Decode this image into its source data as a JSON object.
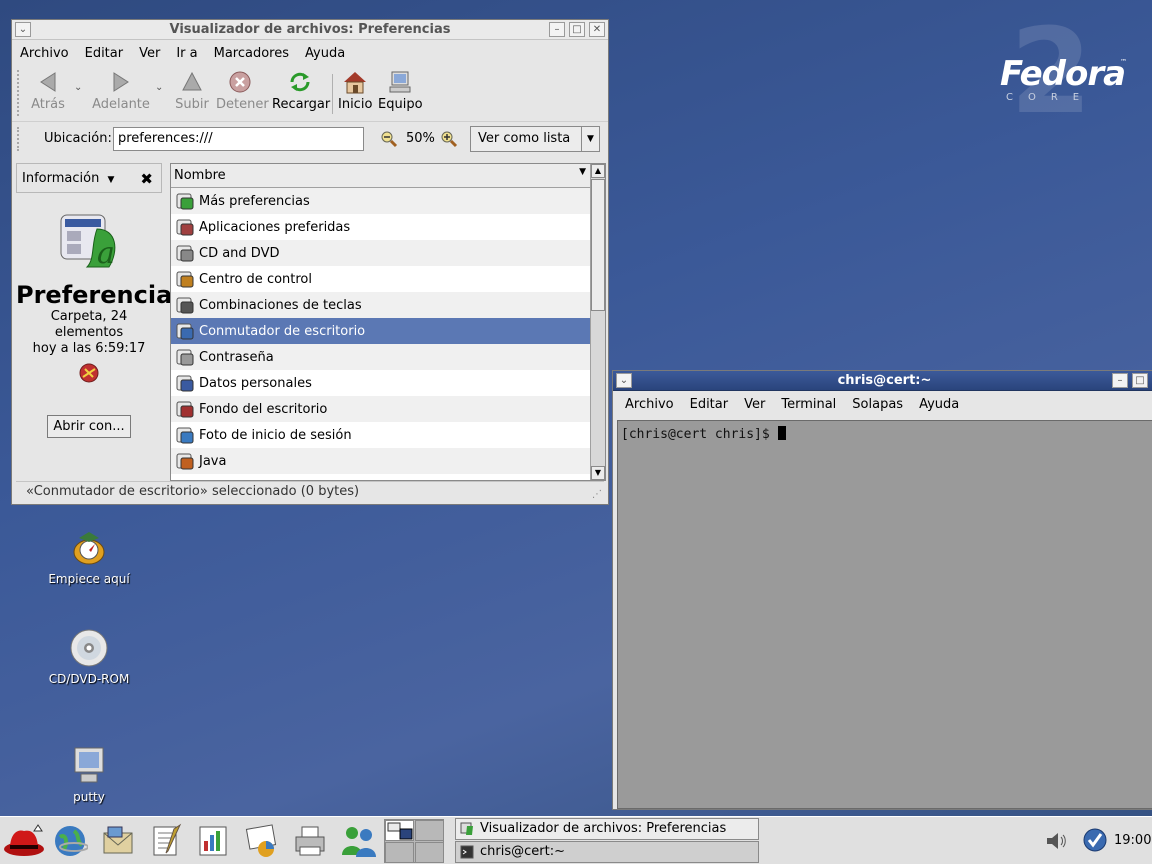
{
  "desktop": {
    "logo": {
      "word": "Fedora",
      "sub": "CORE",
      "version": "2",
      "tm": "™"
    },
    "icons": [
      {
        "label": "Empiece aquí",
        "icon": "start-here-icon"
      },
      {
        "label": "CD/DVD-ROM",
        "icon": "cd-icon"
      },
      {
        "label": "putty",
        "icon": "computer-icon"
      }
    ]
  },
  "filemanager": {
    "title": "Visualizador de archivos: Preferencias",
    "menu": [
      "Archivo",
      "Editar",
      "Ver",
      "Ir a",
      "Marcadores",
      "Ayuda"
    ],
    "toolbar": {
      "back": "Atrás",
      "forward": "Adelante",
      "up": "Subir",
      "stop": "Detener",
      "reload": "Recargar",
      "home": "Inicio",
      "computer": "Equipo"
    },
    "location_label": "Ubicación:",
    "location_value": "preferences:///",
    "zoom": "50%",
    "view_as": "Ver como lista",
    "side": {
      "header": "Información",
      "title": "Preferencias",
      "info_line1": "Carpeta, 24 elementos",
      "info_line2": "hoy a las 6:59:17",
      "open_with": "Abrir con..."
    },
    "list_header": "Nombre",
    "items": [
      "Más preferencias",
      "Aplicaciones preferidas",
      "CD and DVD",
      "Centro de control",
      "Combinaciones de teclas",
      "Conmutador de escritorio",
      "Contraseña",
      "Datos personales",
      "Fondo del escritorio",
      "Foto de inicio de sesión",
      "Java"
    ],
    "selected_index": 5,
    "status": "«Conmutador de escritorio» seleccionado (0 bytes)"
  },
  "terminal": {
    "title": "chris@cert:~",
    "menu": [
      "Archivo",
      "Editar",
      "Ver",
      "Terminal",
      "Solapas",
      "Ayuda"
    ],
    "prompt": "[chris@cert chris]$ "
  },
  "panel": {
    "tasks": [
      "Visualizador de archivos: Preferencias",
      "chris@cert:~"
    ],
    "clock": "19:00"
  }
}
